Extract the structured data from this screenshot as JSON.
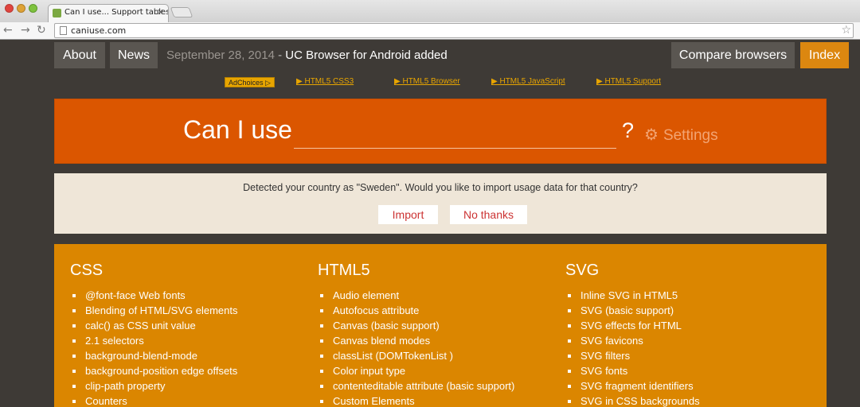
{
  "browser": {
    "tab_title": "Can I use... Support tables",
    "url": "caniuse.com"
  },
  "nav": {
    "about": "About",
    "news": "News",
    "news_date": "September 28, 2014",
    "news_sep": " - ",
    "news_headline": "UC Browser for Android added",
    "compare": "Compare browsers",
    "index": "Index"
  },
  "ads": {
    "adchoices": "AdChoices ▷",
    "links": [
      "▶ HTML5 CSS3",
      "▶ HTML5 Browser",
      "▶ HTML5 JavaScript",
      "▶ HTML5 Support"
    ]
  },
  "search": {
    "heading": "Can I use",
    "value": "",
    "qmark": "?",
    "settings_label": "Settings"
  },
  "notice": {
    "text": "Detected your country as \"Sweden\". Would you like to import usage data for that country?",
    "import": "Import",
    "no_thanks": "No thanks"
  },
  "features": {
    "css": {
      "title": "CSS",
      "items": [
        "@font-face Web fonts",
        "Blending of HTML/SVG elements",
        "calc() as CSS unit value",
        "2.1 selectors",
        "background-blend-mode",
        "background-position edge offsets",
        "clip-path property",
        "Counters"
      ]
    },
    "html5": {
      "title": "HTML5",
      "items": [
        "Audio element",
        "Autofocus attribute",
        "Canvas (basic support)",
        "Canvas blend modes",
        "classList (DOMTokenList )",
        "Color input type",
        "contenteditable attribute (basic support)",
        "Custom Elements"
      ]
    },
    "svg": {
      "title": "SVG",
      "items": [
        "Inline SVG in HTML5",
        "SVG (basic support)",
        "SVG effects for HTML",
        "SVG favicons",
        "SVG filters",
        "SVG fonts",
        "SVG fragment identifiers",
        "SVG in CSS backgrounds"
      ]
    }
  },
  "colors": {
    "search_bg": "#db5600",
    "features_bg": "#db8600",
    "index_accent": "#dc8710",
    "notice_bg": "#efe6d8"
  }
}
